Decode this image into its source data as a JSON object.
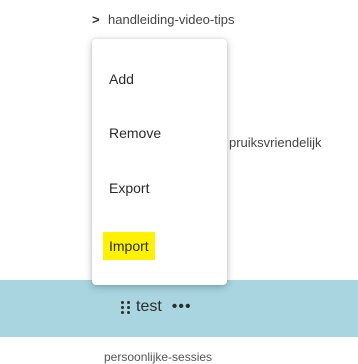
{
  "tree": {
    "rows": [
      {
        "chevron": ">",
        "label": "handleiding-video-tips"
      },
      {
        "chevron": ">",
        "label": ""
      },
      {
        "chevron": ">",
        "label": "pruiksvriendelijk"
      }
    ],
    "selected": {
      "label": "test",
      "more_label": "•••"
    },
    "bottom_label": "persoonlijke-sessies"
  },
  "context_menu": {
    "items": [
      {
        "label": "Add"
      },
      {
        "label": "Remove"
      },
      {
        "label": "Export"
      },
      {
        "label": "Import"
      }
    ],
    "highlight_color": "#fff200"
  },
  "colors": {
    "selected_row": "#a9d5e0"
  }
}
